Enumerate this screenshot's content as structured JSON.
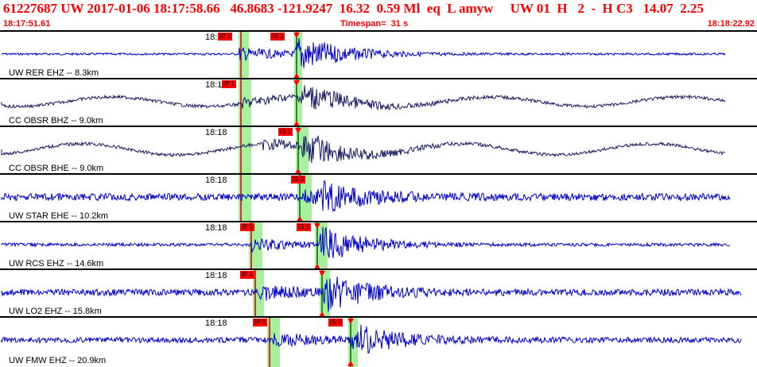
{
  "header": {
    "title": "61227687 UW 2017-01-06 18:17:58.66   46.8683 -121.9247  16.32  0.59 Ml  eq  L amyw     UW 01  H   2  -  H C3   14.07  2.25",
    "start_time": "18:17:51.61",
    "timespan": "Timespan=  31 s",
    "end_time": "18:18:22.92"
  },
  "colors": {
    "header_text": "#ff0000",
    "trace_blue": "#0000cc",
    "trace_navy": "#1c1c66",
    "pick_window": "#a8f0a0",
    "pick_box": "#ff0000"
  },
  "panels": [
    {
      "station": "UW RER EHZ -- 8.3km",
      "time_label": "18:18",
      "picks": [
        "IP 1",
        "IS 1"
      ]
    },
    {
      "station": "CC OBSR BHZ -- 9.0km",
      "time_label": "18:18",
      "picks": [
        "IP 1"
      ]
    },
    {
      "station": "CC OBSR BHE -- 9.0km",
      "time_label": "18:18",
      "picks": [
        "IS 1"
      ]
    },
    {
      "station": "UW STAR EHE -- 10.2km",
      "time_label": "18:18",
      "picks": [
        "IS 0"
      ]
    },
    {
      "station": "UW RCS EHZ -- 14.6km",
      "time_label": "18:18",
      "picks": [
        "IP 1",
        "IS 1"
      ]
    },
    {
      "station": "UW LO2 EHZ -- 15.8km",
      "time_label": "18:18",
      "picks": [
        "IP 1"
      ]
    },
    {
      "station": "UW FMW EHZ -- 20.9km",
      "time_label": "18:18",
      "picks": [
        "IP 1",
        "IS 1"
      ]
    }
  ]
}
